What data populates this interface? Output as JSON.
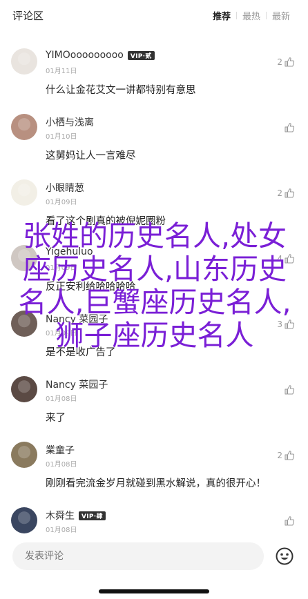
{
  "header": {
    "title": "评论区",
    "tabs": [
      {
        "label": "推荐",
        "active": true
      },
      {
        "label": "最热",
        "active": false
      },
      {
        "label": "最新",
        "active": false
      }
    ]
  },
  "comments": [
    {
      "name": "YIMOooooooooo",
      "vip": "VIP·贰",
      "date": "01月11日",
      "likes": "2",
      "text": "什么让金花艾文一讲都特别有意思",
      "avatar": "#e9e4df"
    },
    {
      "name": "小栖与浅离",
      "vip": "",
      "date": "01月10日",
      "likes": "",
      "text": "这舅妈让人一言难尽",
      "avatar": "#b89080"
    },
    {
      "name": "小眼睛葱",
      "vip": "",
      "date": "01月09日",
      "likes": "2",
      "text": "看了这个剧真的被倪妮圈粉",
      "avatar": "#f2efe6"
    },
    {
      "name": "Yigehuluo",
      "vip": "",
      "date": "01月09日",
      "likes": "4",
      "text": "反正安利给哈哈哈哈",
      "avatar": "#cfc7c2"
    },
    {
      "name": "Nancy 菜园子",
      "vip": "",
      "date": "01月09日",
      "likes": "3",
      "text": "是不是收广告了",
      "avatar": "#6f5f58"
    },
    {
      "name": "Nancy 菜园子",
      "vip": "",
      "date": "01月08日",
      "likes": "",
      "text": "来了",
      "avatar": "#5b4a44"
    },
    {
      "name": "業童子",
      "vip": "",
      "date": "01月08日",
      "likes": "2",
      "text": "刚刚看完流金岁月就碰到黑水解说，真的很开心！",
      "avatar": "#8a7a5e"
    },
    {
      "name": "木舜生",
      "vip": "VIP·肆",
      "date": "01月08日",
      "likes": "",
      "text": "",
      "avatar": "#3a4660"
    }
  ],
  "overlay_text": "张姓的历史名人,处女座历史名人,山东历史名人,巨蟹座历史名人,狮子座历史名人",
  "composer": {
    "placeholder": "发表评论"
  },
  "icons": {
    "like": "thumb-up-icon",
    "emoji": "smiley-icon"
  }
}
